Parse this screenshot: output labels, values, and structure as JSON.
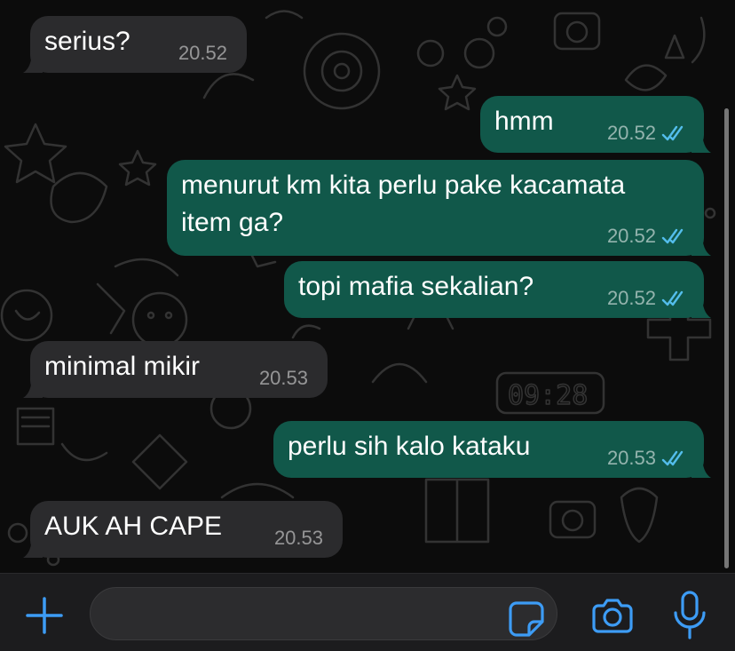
{
  "chat": {
    "messages": [
      {
        "direction": "incoming",
        "text": "serius?",
        "time": "20.52"
      },
      {
        "direction": "outgoing",
        "text": "hmm",
        "time": "20.52",
        "status": "read"
      },
      {
        "direction": "outgoing",
        "text_line1": "menurut km kita perlu pake kacamata",
        "text_line2": "item ga?",
        "time": "20.52",
        "status": "read"
      },
      {
        "direction": "outgoing",
        "text": "topi mafia sekalian?",
        "time": "20.52",
        "status": "read"
      },
      {
        "direction": "incoming",
        "text": "minimal mikir",
        "time": "20.53"
      },
      {
        "direction": "outgoing",
        "text": "perlu sih kalo kataku",
        "time": "20.53",
        "status": "read"
      },
      {
        "direction": "incoming",
        "text": "AUK AH CAPE",
        "time": "20.53"
      }
    ]
  },
  "input_bar": {
    "message_value": "",
    "icons": {
      "attach": "plus-icon",
      "sticker": "sticker-icon",
      "camera": "camera-icon",
      "microphone": "microphone-icon"
    }
  },
  "colors": {
    "background": "#0c0c0c",
    "incoming_bubble": "#2b2b2d",
    "outgoing_bubble": "#11584a",
    "accent": "#3d9cf5",
    "read_ticks": "#53bdeb"
  }
}
